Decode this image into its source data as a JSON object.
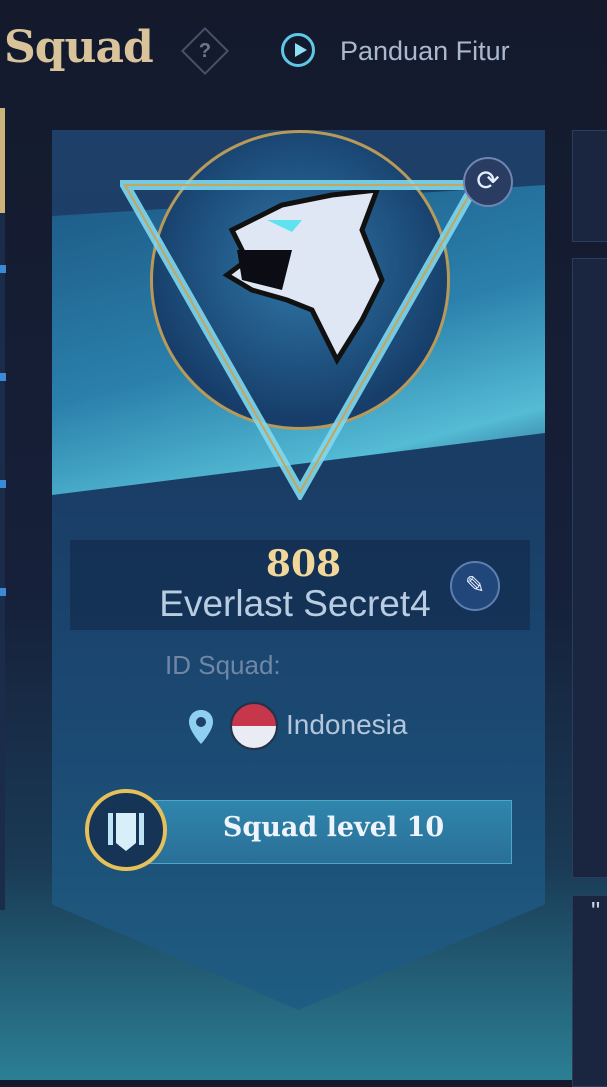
{
  "header": {
    "title": "Squad",
    "help_icon": "question-diamond-icon",
    "guide_label": "Panduan Fitur",
    "guide_icon": "play-circle-icon"
  },
  "squad": {
    "points": "808",
    "name": "Everlast Secret4",
    "id_label": "ID Squad:",
    "country": "Indonesia",
    "level_label": "Squad level 10",
    "emblem": "wolf-emblem-icon"
  },
  "colors": {
    "accent_gold": "#d9c39a",
    "accent_cyan": "#5fc8e6",
    "flag_red": "#c7374b",
    "badge_ring": "#e6c15a"
  },
  "right_panel": {
    "partial_text": "\""
  }
}
